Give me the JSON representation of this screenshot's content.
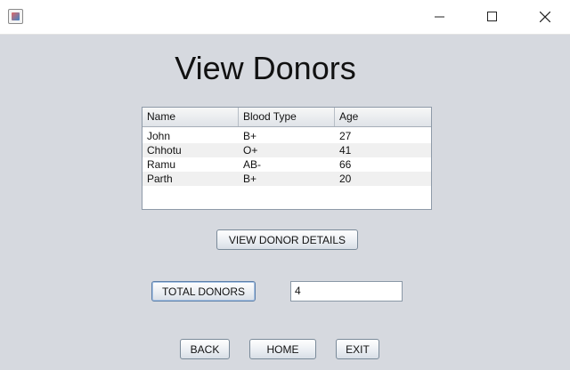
{
  "window": {
    "icon": "java-app-icon"
  },
  "header": {
    "title": "View Donors"
  },
  "table": {
    "columns": [
      "Name",
      "Blood Type",
      "Age"
    ],
    "rows": [
      [
        "John",
        "B+",
        "27"
      ],
      [
        "Chhotu",
        "O+",
        "41"
      ],
      [
        "Ramu",
        "AB-",
        "66"
      ],
      [
        "Parth",
        "B+",
        "20"
      ]
    ]
  },
  "actions": {
    "view_details_label": "VIEW DONOR DETAILS",
    "total_label": "TOTAL DONORS",
    "total_value": "4",
    "back_label": "BACK",
    "home_label": "HOME",
    "exit_label": "EXIT"
  },
  "colors": {
    "background": "#d6d9df",
    "titlebar": "#ffffff",
    "button_border": "#7a8a99"
  }
}
